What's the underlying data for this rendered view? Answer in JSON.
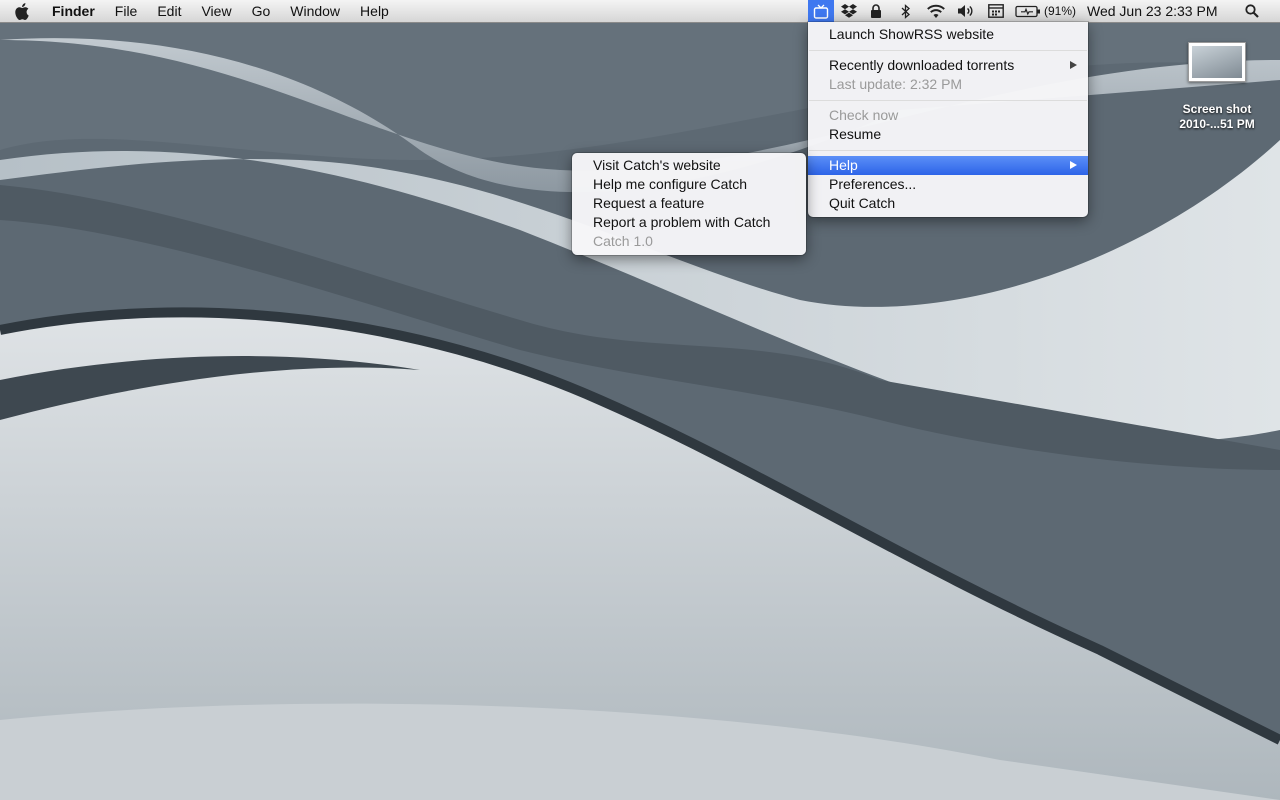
{
  "menubar": {
    "app_name": "Finder",
    "menus": [
      "File",
      "Edit",
      "View",
      "Go",
      "Window",
      "Help"
    ],
    "status_icons": [
      "catch-tv-icon",
      "dropbox-icon",
      "lock-icon",
      "bluetooth-icon",
      "wifi-icon",
      "volume-icon",
      "calendar-icon",
      "battery-icon",
      "spotlight-icon"
    ],
    "battery_percent": "(91%)",
    "clock": "Wed Jun 23  2:33 PM"
  },
  "catch_menu": {
    "launch": "Launch ShowRSS website",
    "recent": "Recently downloaded torrents",
    "last_update": "Last update: 2:32 PM",
    "check_now": "Check now",
    "resume": "Resume",
    "help": "Help",
    "preferences": "Preferences...",
    "quit": "Quit Catch"
  },
  "help_submenu": {
    "visit": "Visit Catch's website",
    "configure": "Help me configure Catch",
    "request": "Request a feature",
    "report": "Report a problem with Catch",
    "version": "Catch 1.0"
  },
  "desktop": {
    "icon_label_1": "Screen shot",
    "icon_label_2": "2010-...51 PM"
  },
  "colors": {
    "highlight": "#2d64e8",
    "menubar": "#e4e4e4",
    "wallpaper": "#8f9aa3"
  }
}
